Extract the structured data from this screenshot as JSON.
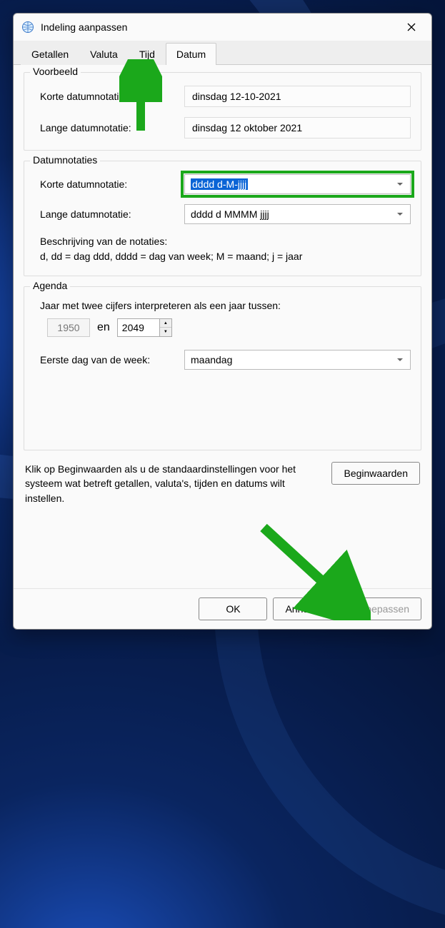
{
  "window": {
    "title": "Indeling aanpassen"
  },
  "tabs": {
    "numbers": "Getallen",
    "currency": "Valuta",
    "time": "Tijd",
    "date": "Datum"
  },
  "example": {
    "legend": "Voorbeeld",
    "short_label": "Korte datumnotatie:",
    "short_value": "dinsdag 12-10-2021",
    "long_label": "Lange datumnotatie:",
    "long_value": "dinsdag 12 oktober 2021"
  },
  "formats": {
    "legend": "Datumnotaties",
    "short_label": "Korte datumnotatie:",
    "short_value": "dddd d-M-jjjj",
    "long_label": "Lange datumnotatie:",
    "long_value": "dddd d MMMM jjjj",
    "desc_title": "Beschrijving van de notaties:",
    "desc_body": "d, dd = dag  ddd, dddd = dag van week;  M = maand;  j = jaar"
  },
  "calendar": {
    "legend": "Agenda",
    "year_label": "Jaar met twee cijfers interpreteren als een jaar tussen:",
    "year_from": "1950",
    "year_and": "en",
    "year_to": "2049",
    "firstday_label": "Eerste dag van de week:",
    "firstday_value": "maandag"
  },
  "reset": {
    "text": "Klik op Beginwaarden als u de standaardinstellingen voor het systeem wat betreft getallen, valuta's, tijden en datums wilt instellen.",
    "button": "Beginwaarden"
  },
  "buttons": {
    "ok": "OK",
    "cancel": "Annuleren",
    "apply": "Toepassen"
  }
}
